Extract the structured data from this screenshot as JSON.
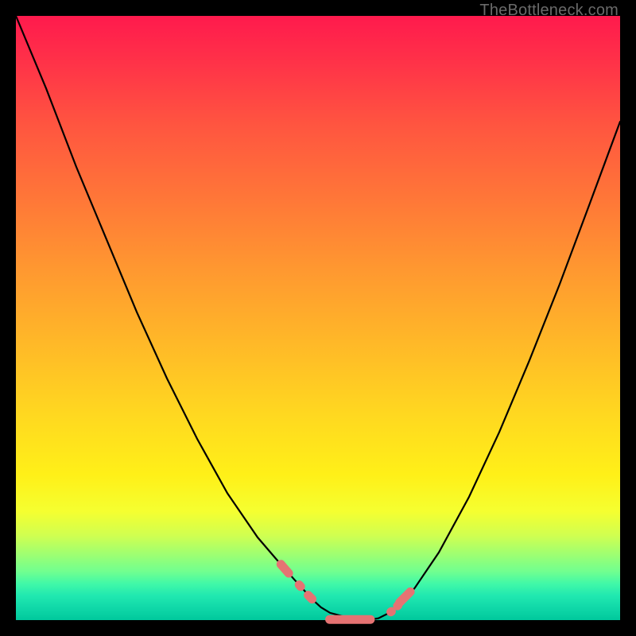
{
  "watermark": {
    "text": "TheBottleneck.com"
  },
  "chart_data": {
    "type": "line",
    "title": "",
    "xlabel": "",
    "ylabel": "",
    "xlim": [
      0,
      100
    ],
    "ylim": [
      0,
      100
    ],
    "grid": false,
    "legend": false,
    "background_gradient": {
      "top": "#ff1a4d",
      "bottom": "#00c89c",
      "stops": [
        "#ff1a4d",
        "#ff5540",
        "#ff9830",
        "#ffd820",
        "#f5ff30",
        "#70ff90",
        "#00c89c"
      ]
    },
    "series": [
      {
        "name": "left-curve",
        "type": "line",
        "color": "#000000",
        "x": [
          0,
          5,
          10,
          15,
          20,
          25,
          30,
          35,
          40,
          43,
          46,
          48,
          49.2,
          50.5,
          52,
          55,
          57,
          58.3
        ],
        "y": [
          100,
          88,
          75,
          63,
          51,
          40,
          30,
          21,
          13.7,
          10.2,
          6.8,
          4.6,
          3.3,
          2.1,
          1.2,
          0.4,
          0.1,
          0
        ]
      },
      {
        "name": "right-curve",
        "type": "line",
        "color": "#000000",
        "x": [
          58.3,
          60,
          62,
          64,
          66,
          70,
          75,
          80,
          85,
          90,
          95,
          100
        ],
        "y": [
          0,
          0.3,
          1.3,
          3.0,
          5.3,
          11.2,
          20.4,
          31.1,
          43.0,
          55.6,
          69.0,
          82.5
        ]
      },
      {
        "name": "left-markers",
        "type": "scatter",
        "color": "#e57373",
        "marker": "rounded-capsule",
        "x": [
          44.5,
          47.0,
          48.7
        ],
        "y": [
          8.5,
          5.7,
          3.8
        ]
      },
      {
        "name": "right-markers",
        "type": "scatter",
        "color": "#e57373",
        "marker": "rounded-capsule",
        "x": [
          62.1,
          63.2,
          64.4
        ],
        "y": [
          1.4,
          2.4,
          3.8
        ]
      },
      {
        "name": "bottom-bar",
        "type": "scatter",
        "color": "#e57373",
        "marker": "rounded-bar",
        "x_range": [
          51.2,
          59.4
        ],
        "y": [
          0.1
        ]
      }
    ]
  }
}
